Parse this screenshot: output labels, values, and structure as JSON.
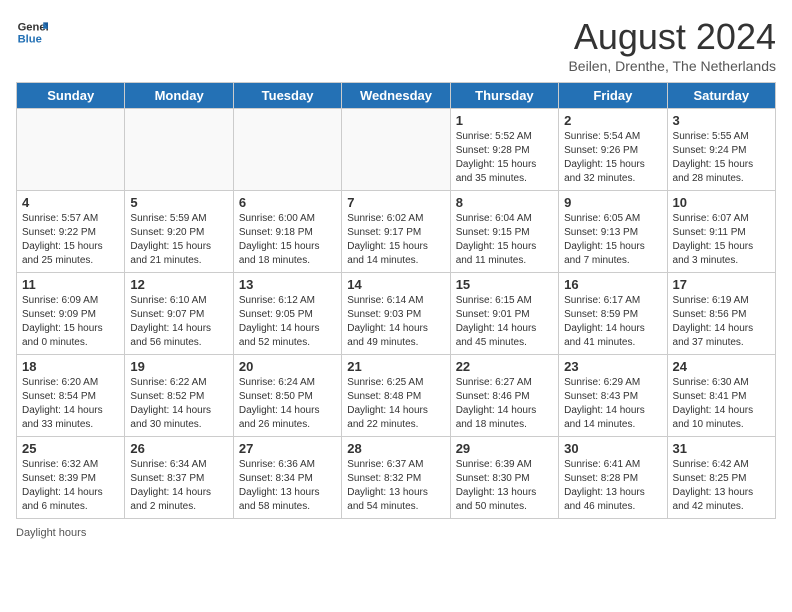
{
  "header": {
    "logo_line1": "General",
    "logo_line2": "Blue",
    "title": "August 2024",
    "subtitle": "Beilen, Drenthe, The Netherlands"
  },
  "days_of_week": [
    "Sunday",
    "Monday",
    "Tuesday",
    "Wednesday",
    "Thursday",
    "Friday",
    "Saturday"
  ],
  "footer": {
    "daylight_label": "Daylight hours"
  },
  "weeks": [
    [
      {
        "num": "",
        "detail": ""
      },
      {
        "num": "",
        "detail": ""
      },
      {
        "num": "",
        "detail": ""
      },
      {
        "num": "",
        "detail": ""
      },
      {
        "num": "1",
        "detail": "Sunrise: 5:52 AM\nSunset: 9:28 PM\nDaylight: 15 hours\nand 35 minutes."
      },
      {
        "num": "2",
        "detail": "Sunrise: 5:54 AM\nSunset: 9:26 PM\nDaylight: 15 hours\nand 32 minutes."
      },
      {
        "num": "3",
        "detail": "Sunrise: 5:55 AM\nSunset: 9:24 PM\nDaylight: 15 hours\nand 28 minutes."
      }
    ],
    [
      {
        "num": "4",
        "detail": "Sunrise: 5:57 AM\nSunset: 9:22 PM\nDaylight: 15 hours\nand 25 minutes."
      },
      {
        "num": "5",
        "detail": "Sunrise: 5:59 AM\nSunset: 9:20 PM\nDaylight: 15 hours\nand 21 minutes."
      },
      {
        "num": "6",
        "detail": "Sunrise: 6:00 AM\nSunset: 9:18 PM\nDaylight: 15 hours\nand 18 minutes."
      },
      {
        "num": "7",
        "detail": "Sunrise: 6:02 AM\nSunset: 9:17 PM\nDaylight: 15 hours\nand 14 minutes."
      },
      {
        "num": "8",
        "detail": "Sunrise: 6:04 AM\nSunset: 9:15 PM\nDaylight: 15 hours\nand 11 minutes."
      },
      {
        "num": "9",
        "detail": "Sunrise: 6:05 AM\nSunset: 9:13 PM\nDaylight: 15 hours\nand 7 minutes."
      },
      {
        "num": "10",
        "detail": "Sunrise: 6:07 AM\nSunset: 9:11 PM\nDaylight: 15 hours\nand 3 minutes."
      }
    ],
    [
      {
        "num": "11",
        "detail": "Sunrise: 6:09 AM\nSunset: 9:09 PM\nDaylight: 15 hours\nand 0 minutes."
      },
      {
        "num": "12",
        "detail": "Sunrise: 6:10 AM\nSunset: 9:07 PM\nDaylight: 14 hours\nand 56 minutes."
      },
      {
        "num": "13",
        "detail": "Sunrise: 6:12 AM\nSunset: 9:05 PM\nDaylight: 14 hours\nand 52 minutes."
      },
      {
        "num": "14",
        "detail": "Sunrise: 6:14 AM\nSunset: 9:03 PM\nDaylight: 14 hours\nand 49 minutes."
      },
      {
        "num": "15",
        "detail": "Sunrise: 6:15 AM\nSunset: 9:01 PM\nDaylight: 14 hours\nand 45 minutes."
      },
      {
        "num": "16",
        "detail": "Sunrise: 6:17 AM\nSunset: 8:59 PM\nDaylight: 14 hours\nand 41 minutes."
      },
      {
        "num": "17",
        "detail": "Sunrise: 6:19 AM\nSunset: 8:56 PM\nDaylight: 14 hours\nand 37 minutes."
      }
    ],
    [
      {
        "num": "18",
        "detail": "Sunrise: 6:20 AM\nSunset: 8:54 PM\nDaylight: 14 hours\nand 33 minutes."
      },
      {
        "num": "19",
        "detail": "Sunrise: 6:22 AM\nSunset: 8:52 PM\nDaylight: 14 hours\nand 30 minutes."
      },
      {
        "num": "20",
        "detail": "Sunrise: 6:24 AM\nSunset: 8:50 PM\nDaylight: 14 hours\nand 26 minutes."
      },
      {
        "num": "21",
        "detail": "Sunrise: 6:25 AM\nSunset: 8:48 PM\nDaylight: 14 hours\nand 22 minutes."
      },
      {
        "num": "22",
        "detail": "Sunrise: 6:27 AM\nSunset: 8:46 PM\nDaylight: 14 hours\nand 18 minutes."
      },
      {
        "num": "23",
        "detail": "Sunrise: 6:29 AM\nSunset: 8:43 PM\nDaylight: 14 hours\nand 14 minutes."
      },
      {
        "num": "24",
        "detail": "Sunrise: 6:30 AM\nSunset: 8:41 PM\nDaylight: 14 hours\nand 10 minutes."
      }
    ],
    [
      {
        "num": "25",
        "detail": "Sunrise: 6:32 AM\nSunset: 8:39 PM\nDaylight: 14 hours\nand 6 minutes."
      },
      {
        "num": "26",
        "detail": "Sunrise: 6:34 AM\nSunset: 8:37 PM\nDaylight: 14 hours\nand 2 minutes."
      },
      {
        "num": "27",
        "detail": "Sunrise: 6:36 AM\nSunset: 8:34 PM\nDaylight: 13 hours\nand 58 minutes."
      },
      {
        "num": "28",
        "detail": "Sunrise: 6:37 AM\nSunset: 8:32 PM\nDaylight: 13 hours\nand 54 minutes."
      },
      {
        "num": "29",
        "detail": "Sunrise: 6:39 AM\nSunset: 8:30 PM\nDaylight: 13 hours\nand 50 minutes."
      },
      {
        "num": "30",
        "detail": "Sunrise: 6:41 AM\nSunset: 8:28 PM\nDaylight: 13 hours\nand 46 minutes."
      },
      {
        "num": "31",
        "detail": "Sunrise: 6:42 AM\nSunset: 8:25 PM\nDaylight: 13 hours\nand 42 minutes."
      }
    ]
  ]
}
